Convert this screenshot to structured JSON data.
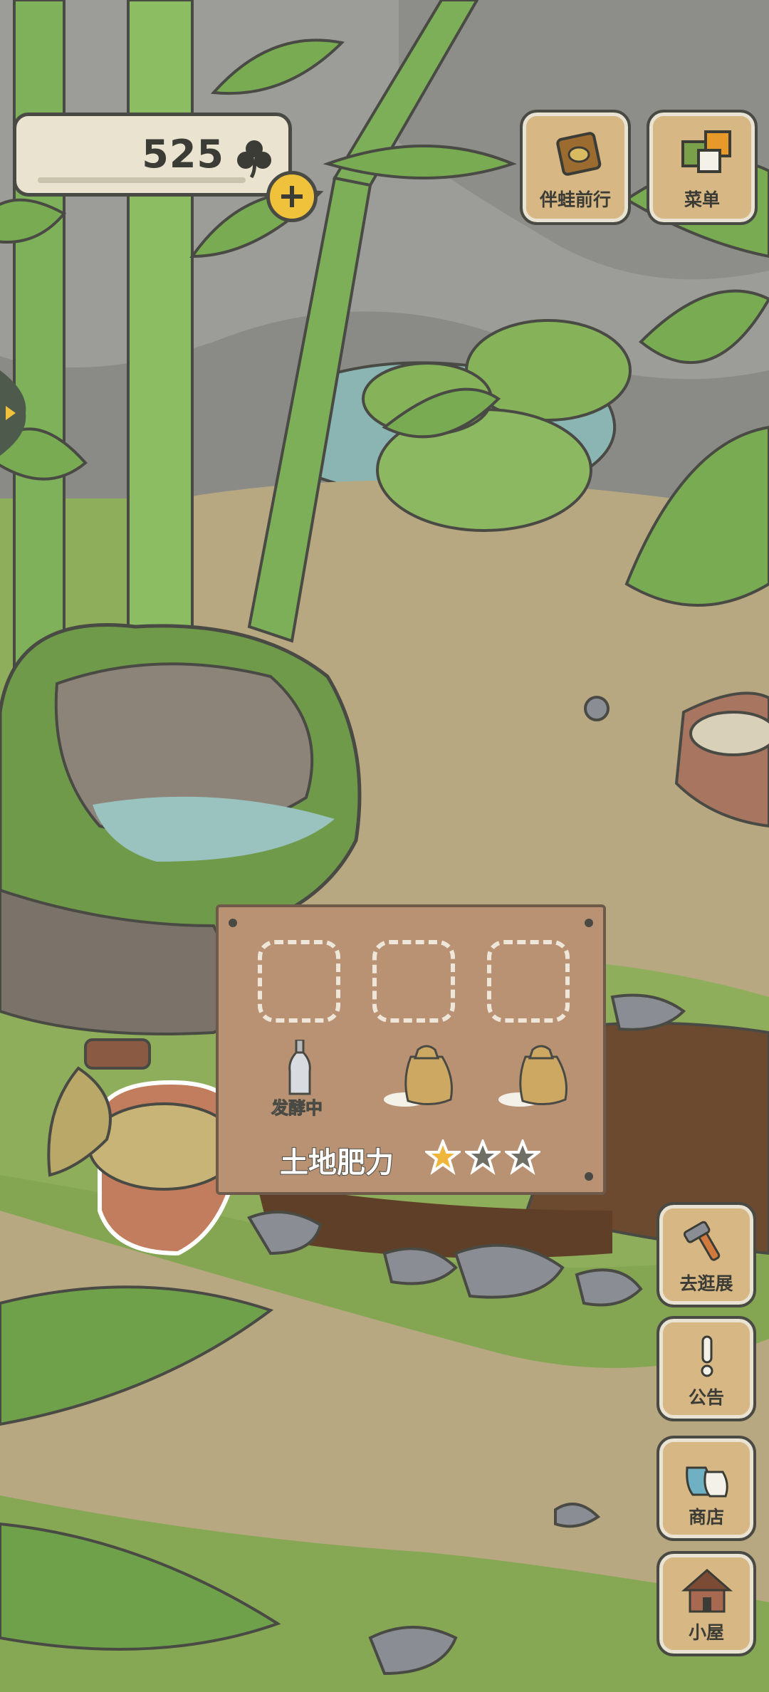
{
  "currency": {
    "count": "525",
    "icon": "clover-icon",
    "add_icon": "plus-icon"
  },
  "top_buttons": [
    {
      "label": "伴蛙前行",
      "icon": "journal-icon"
    },
    {
      "label": "菜单",
      "icon": "menu-cards-icon"
    }
  ],
  "side_buttons": [
    {
      "label": "去逛展",
      "icon": "hammer-icon"
    },
    {
      "label": "公告",
      "icon": "exclamation-icon"
    },
    {
      "label": "商店",
      "icon": "shop-bags-icon"
    },
    {
      "label": "小屋",
      "icon": "house-icon"
    }
  ],
  "garden": {
    "slots": 3,
    "item_status": "发酵中",
    "fertility_label": "土地肥力",
    "fertility_rating": 1,
    "fertility_max": 3
  },
  "colors": {
    "grass": "#8fae5b",
    "path": "#b8a882",
    "button_wood": "#d7b783",
    "outline": "#4a4a44",
    "star_active": "#f0b53b",
    "star_inactive": "#6f6f66"
  }
}
